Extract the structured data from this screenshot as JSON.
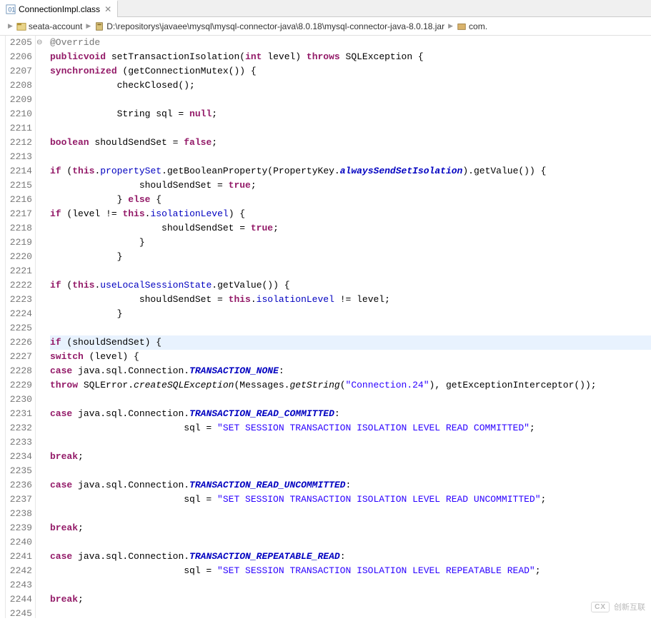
{
  "tab": {
    "filename": "ConnectionImpl.class",
    "icon": "class-file"
  },
  "breadcrumb": {
    "project": "seata-account",
    "jar_path": "D:\\repositorys\\javaee\\mysql\\mysql-connector-java\\8.0.18\\mysql-connector-java-8.0.18.jar",
    "pkg_trail": "com."
  },
  "line_start": 2205,
  "line_end": 2245,
  "highlight_line": 2226,
  "override_marker_line": 2205,
  "code_tokens": {
    "override": "@Override",
    "public": "public",
    "void": "void",
    "int": "int",
    "throws": "throws",
    "synchronized": "synchronized",
    "boolean": "boolean",
    "false": "false",
    "true": "true",
    "null": "null",
    "if": "if",
    "else": "else",
    "this": "this",
    "switch": "switch",
    "case": "case",
    "throw": "throw",
    "break": "break",
    "setTransactionIsolation": "setTransactionIsolation",
    "level_param": "level",
    "SQLException": "SQLException",
    "getConnectionMutex": "getConnectionMutex",
    "checkClosed": "checkClosed",
    "String": "String",
    "sql_var": "sql",
    "shouldSendSet": "shouldSendSet",
    "propertySet": "propertySet",
    "getBooleanProperty": "getBooleanProperty",
    "PropertyKey": "PropertyKey",
    "alwaysSendSetIsolation": "alwaysSendSetIsolation",
    "getValue": "getValue",
    "isolationLevel": "isolationLevel",
    "useLocalSessionState": "useLocalSessionState",
    "javaSqlConnection": "java.sql.Connection",
    "TRANSACTION_NONE": "TRANSACTION_NONE",
    "TRANSACTION_READ_COMMITTED": "TRANSACTION_READ_COMMITTED",
    "TRANSACTION_READ_UNCOMMITTED": "TRANSACTION_READ_UNCOMMITTED",
    "TRANSACTION_REPEATABLE_READ": "TRANSACTION_REPEATABLE_READ",
    "SQLError": "SQLError",
    "createSQLException": "createSQLException",
    "Messages": "Messages",
    "getString": "getString",
    "conn24": "\"Connection.24\"",
    "getExceptionInterceptor": "getExceptionInterceptor",
    "str_read_committed": "\"SET SESSION TRANSACTION ISOLATION LEVEL READ COMMITTED\"",
    "str_read_uncommitted": "\"SET SESSION TRANSACTION ISOLATION LEVEL READ UNCOMMITTED\"",
    "str_repeatable_read": "\"SET SESSION TRANSACTION ISOLATION LEVEL REPEATABLE READ\""
  },
  "watermark": {
    "logo": "CX",
    "text": "创新互联"
  }
}
